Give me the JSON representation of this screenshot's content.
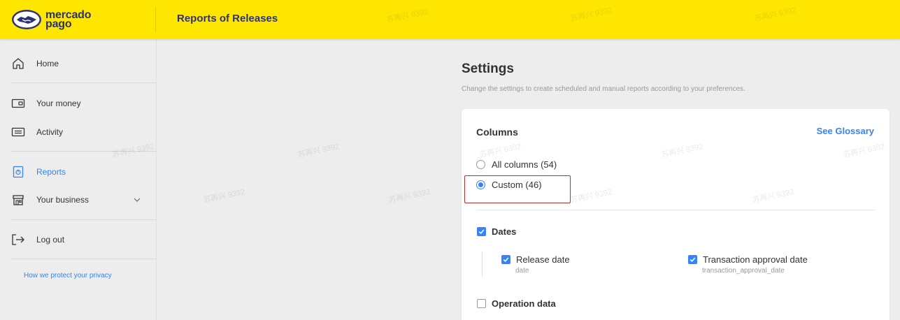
{
  "header": {
    "logo_line1": "mercado",
    "logo_line2": "pago",
    "title": "Reports of Releases"
  },
  "watermark": "苏再兴 9392",
  "sidebar": {
    "items": [
      {
        "label": "Home",
        "icon": "home-icon"
      },
      {
        "label": "Your money",
        "icon": "wallet-icon"
      },
      {
        "label": "Activity",
        "icon": "list-icon"
      },
      {
        "label": "Reports",
        "icon": "reports-icon",
        "active": true
      },
      {
        "label": "Your business",
        "icon": "store-icon"
      },
      {
        "label": "Log out",
        "icon": "logout-icon"
      }
    ],
    "privacy_link": "How we protect your privacy"
  },
  "main": {
    "title": "Settings",
    "subtitle": "Change the settings to create scheduled and manual reports according to your preferences.",
    "card": {
      "title": "Columns",
      "glossary_link": "See Glossary",
      "radio_all": "All columns (54)",
      "radio_custom": "Custom (46)",
      "selected": "custom",
      "groups": {
        "dates": {
          "label": "Dates",
          "checked": true,
          "fields": [
            {
              "label": "Release date",
              "key": "date",
              "checked": true
            },
            {
              "label": "Transaction approval date",
              "key": "transaction_approval_date",
              "checked": true
            }
          ]
        },
        "operation": {
          "label": "Operation data",
          "checked": false
        }
      }
    }
  },
  "colors": {
    "brand_yellow": "#ffe600",
    "brand_navy": "#2d3277",
    "accent_blue": "#3483fa",
    "highlight_red": "#b33030"
  }
}
